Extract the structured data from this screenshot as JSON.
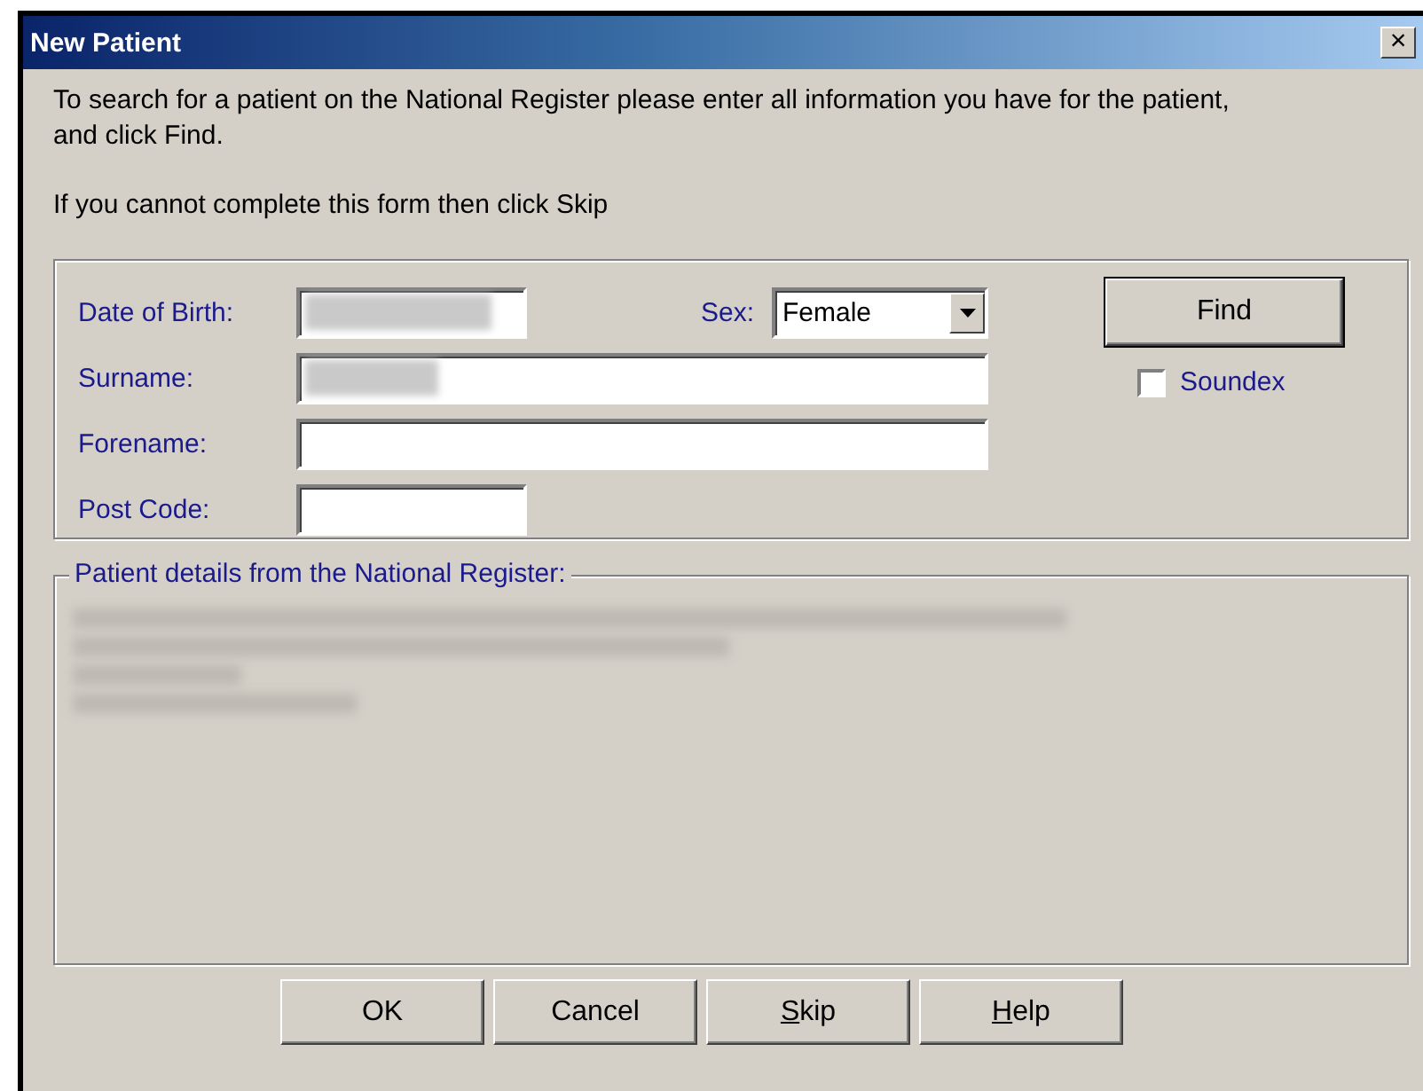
{
  "window": {
    "title": "New Patient",
    "close": "×"
  },
  "intro": [
    "To search for a patient on the National Register please enter all information you have for the patient, and click Find.",
    "If you cannot complete this form then click Skip"
  ],
  "search": {
    "date_of_birth": {
      "label": "Date of Birth:",
      "redacted": true
    },
    "sex": {
      "label": "Sex:",
      "value": "Female"
    },
    "surname": {
      "label": "Surname:",
      "redacted": true
    },
    "forename": {
      "label": "Forename:"
    },
    "post_code": {
      "label": "Post Code:"
    },
    "find": "Find",
    "soundex": {
      "label": "Soundex",
      "checked": false
    }
  },
  "details": {
    "legend": "Patient details from the National Register:",
    "lines": [
      {
        "redacted": true
      },
      {
        "redacted": true
      },
      {
        "redacted": true
      },
      {
        "redacted": true
      }
    ]
  },
  "buttons": [
    {
      "label": "OK",
      "underline_first": false
    },
    {
      "label": "Cancel",
      "underline_first": false
    },
    {
      "label": "Skip",
      "underline_first": true
    },
    {
      "label": "Help",
      "underline_first": true
    }
  ]
}
